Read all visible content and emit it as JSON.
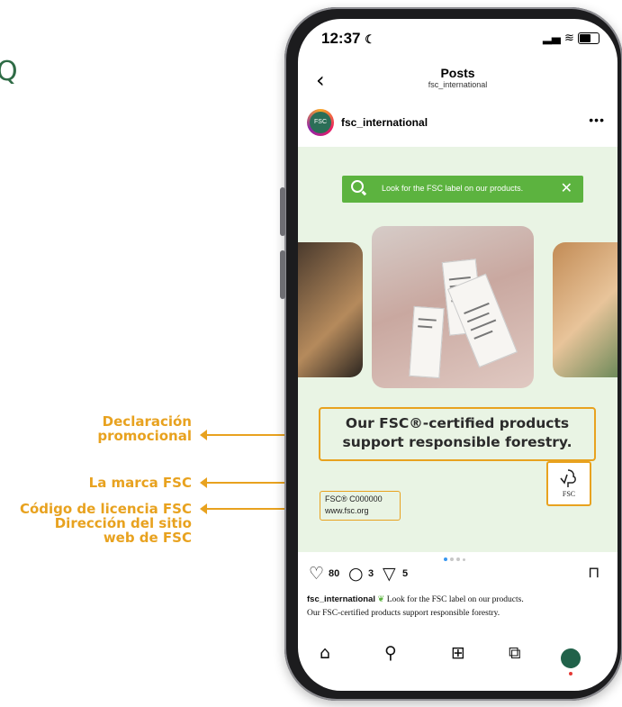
{
  "edge_glyph": "Q",
  "annotations": {
    "promo_line1": "Declaración",
    "promo_line2": "promocional",
    "mark": "La marca FSC",
    "license": "Código de licencia FSC",
    "website_line1": "Dirección del sitio",
    "website_line2": "web de FSC",
    "color": "#e8a21f"
  },
  "status_bar": {
    "time": "12:37",
    "moon": "☾",
    "signal": "▂▄",
    "wifi": "≋",
    "battery": "27"
  },
  "header": {
    "back": "‹",
    "title": "Posts",
    "subtitle": "fsc_international"
  },
  "post_author": {
    "avatar_text": "FSC",
    "username": "fsc_international",
    "more": "•••"
  },
  "post": {
    "search_banner_text": "Look for the FSC label on our products.",
    "close": "✕",
    "claim_line1": "Our FSC®-certified products",
    "claim_line2": "support responsible forestry.",
    "fsc_mark_label": "FSC",
    "license_code": "FSC® C000000",
    "website": "www.fsc.org"
  },
  "actions": {
    "like_count": "80",
    "comment_count": "3",
    "share_count": "5"
  },
  "caption": {
    "username": "fsc_international",
    "line1_text": "Look for the FSC label on our products.",
    "line2": "Our FSC-certified products support responsible forestry."
  },
  "nav_icons": [
    "home-icon",
    "search-icon",
    "create-icon",
    "reels-icon",
    "profile-icon"
  ],
  "colors": {
    "post_bg": "#e9f4e4",
    "banner_green": "#5cb33f",
    "annotation": "#e8a21f"
  }
}
